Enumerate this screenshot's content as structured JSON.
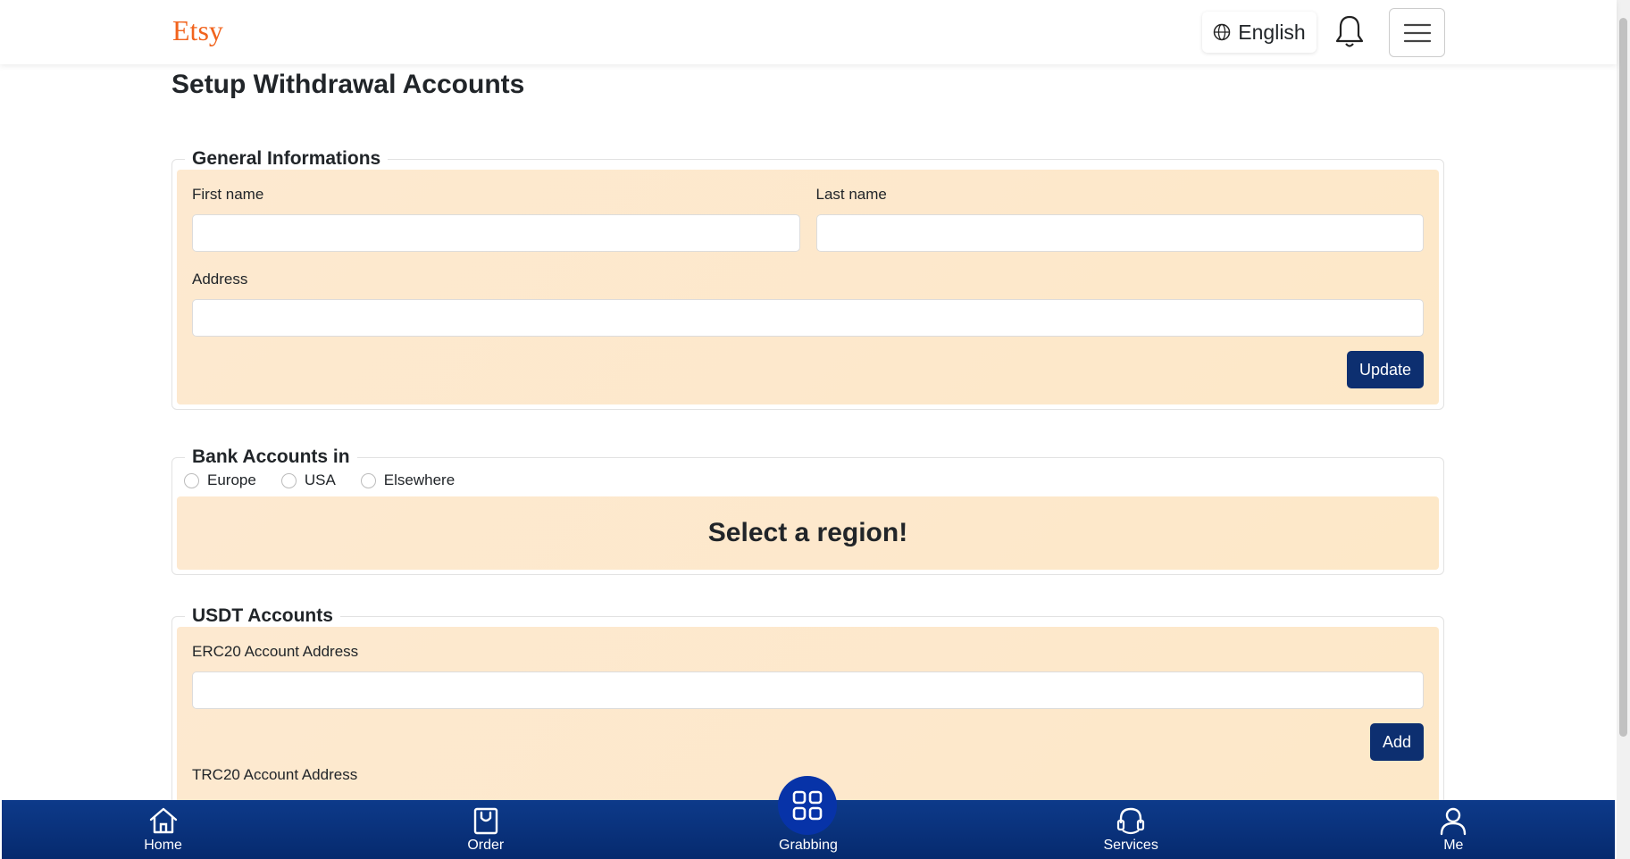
{
  "header": {
    "logo": "Etsy",
    "language": "English"
  },
  "page": {
    "title": "Setup Withdrawal Accounts"
  },
  "general": {
    "legend": "General Informations",
    "first_name_label": "First name",
    "last_name_label": "Last name",
    "address_label": "Address",
    "update_label": "Update"
  },
  "bank": {
    "legend": "Bank Accounts in",
    "regions": [
      "Europe",
      "USA",
      "Elsewhere"
    ],
    "message": "Select a region!"
  },
  "usdt": {
    "legend": "USDT Accounts",
    "erc20_label": "ERC20 Account Address",
    "add_label": "Add",
    "trc20_label": "TRC20 Account Address"
  },
  "nav": {
    "items": [
      "Home",
      "Order",
      "Grabbing",
      "Services",
      "Me"
    ]
  },
  "colors": {
    "brand": "#f1641e",
    "primary": "#0d2f70",
    "panel": "#fde9d0"
  }
}
